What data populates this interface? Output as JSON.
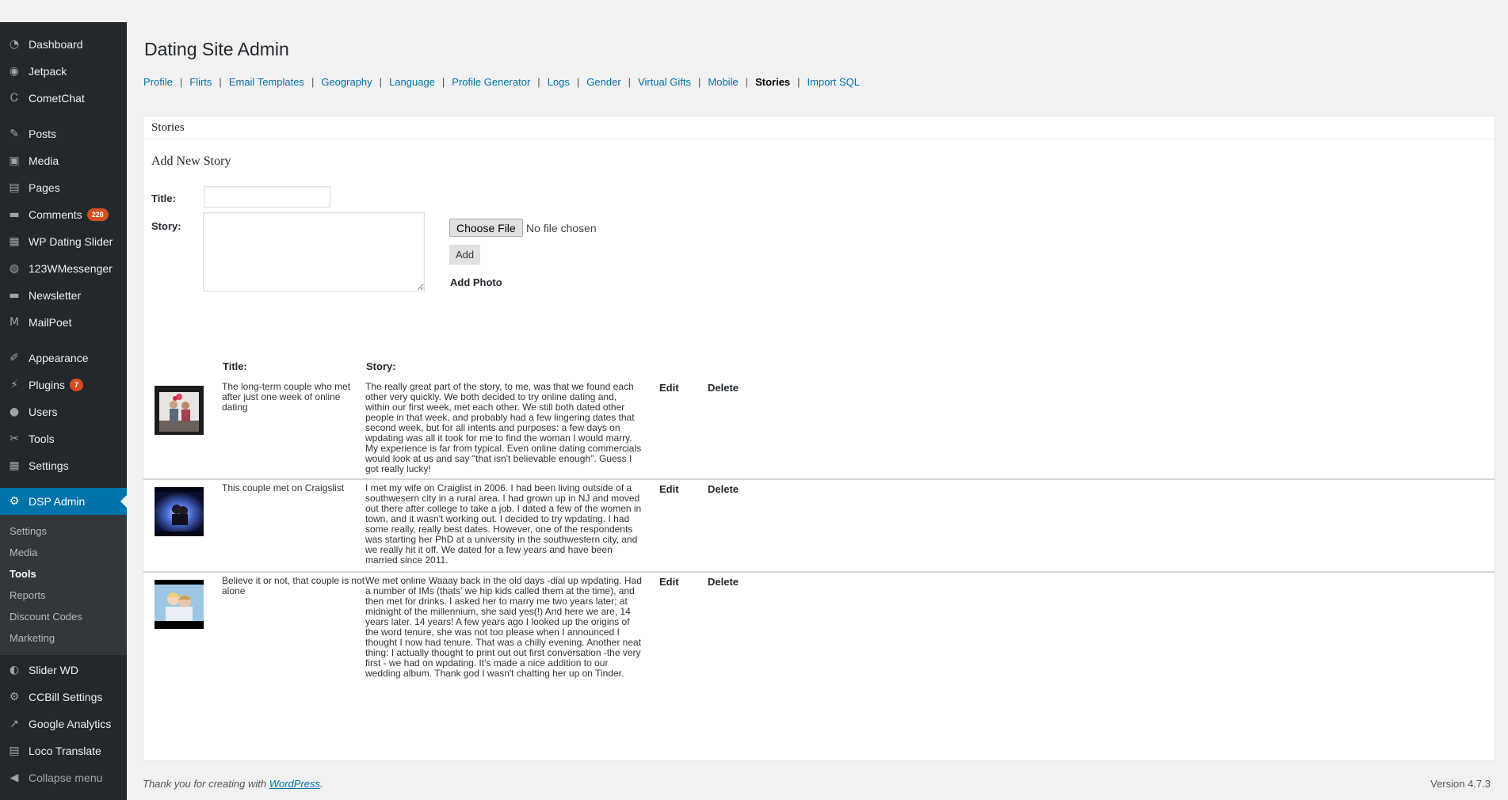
{
  "sidebar": {
    "group1": [
      {
        "label": "Dashboard",
        "icon": "dashboard-icon",
        "glyph": "◔"
      },
      {
        "label": "Jetpack",
        "icon": "jetpack-icon",
        "glyph": "◉"
      },
      {
        "label": "CometChat",
        "icon": "cometchat-icon",
        "glyph": "Ꮯ"
      }
    ],
    "group2": [
      {
        "label": "Posts",
        "icon": "pin-icon",
        "glyph": "✎"
      },
      {
        "label": "Media",
        "icon": "media-icon",
        "glyph": "▣"
      },
      {
        "label": "Pages",
        "icon": "pages-icon",
        "glyph": "▤"
      },
      {
        "label": "Comments",
        "icon": "comment-icon",
        "glyph": "▬",
        "badge": "228"
      },
      {
        "label": "WP Dating Slider",
        "icon": "slider-icon",
        "glyph": "▦"
      },
      {
        "label": "123WMessenger",
        "icon": "messenger-icon",
        "glyph": "◍"
      },
      {
        "label": "Newsletter",
        "icon": "newsletter-icon",
        "glyph": "▬"
      },
      {
        "label": "MailPoet",
        "icon": "mailpoet-icon",
        "glyph": "M"
      }
    ],
    "group3": [
      {
        "label": "Appearance",
        "icon": "brush-icon",
        "glyph": "✐"
      },
      {
        "label": "Plugins",
        "icon": "plug-icon",
        "glyph": "⚡",
        "badge": "7"
      },
      {
        "label": "Users",
        "icon": "user-icon",
        "glyph": "●"
      },
      {
        "label": "Tools",
        "icon": "wrench-icon",
        "glyph": "✂"
      },
      {
        "label": "Settings",
        "icon": "settings-icon",
        "glyph": "▦"
      }
    ],
    "active": {
      "label": "DSP Admin",
      "icon": "gear-icon",
      "glyph": "⚙"
    },
    "submenu": [
      "Settings",
      "Media",
      "Tools",
      "Reports",
      "Discount Codes",
      "Marketing"
    ],
    "submenu_current": "Tools",
    "group4": [
      {
        "label": "Slider WD",
        "icon": "slider-wd-icon",
        "glyph": "◐"
      },
      {
        "label": "CCBill Settings",
        "icon": "gear-icon",
        "glyph": "⚙"
      },
      {
        "label": "Google Analytics",
        "icon": "analytics-icon",
        "glyph": "↗"
      },
      {
        "label": "Loco Translate",
        "icon": "translate-icon",
        "glyph": "▤"
      }
    ],
    "collapse": {
      "label": "Collapse menu",
      "icon": "collapse-icon",
      "glyph": "◀"
    }
  },
  "page": {
    "title": "Dating Site Admin",
    "tabs": [
      "Profile",
      "Flirts",
      "Email Templates",
      "Geography",
      "Language",
      "Profile Generator",
      "Logs",
      "Gender",
      "Virtual Gifts",
      "Mobile",
      "Stories",
      "Import SQL"
    ],
    "current_tab": "Stories"
  },
  "panel": {
    "heading": "Stories",
    "form_title": "Add New Story",
    "title_label": "Title:",
    "story_label": "Story:",
    "title_value": "",
    "choose_file": "Choose File",
    "no_file": "No file chosen",
    "add": "Add",
    "add_photo": "Add Photo",
    "col_title": "Title:",
    "col_story": "Story:",
    "edit": "Edit",
    "delete": "Delete",
    "rows": [
      {
        "title": "The long-term couple who met after just one week of online dating",
        "story": "The really great part of the story, to me, was that we found each other very quickly. We both decided to try online dating and, within our first week, met each other. We still both dated other people in that week, and probably had a few lingering dates that second week, but for all intents and purposes: a few days on wpdating was all it took for me to find the woman I would marry. My experience is far from typical. Even online dating commercials would look at us and say \"that isn't believable enough\". Guess I got really lucky!"
      },
      {
        "title": "This couple met on Craigslist",
        "story": "I met my wife on Craiglist in 2006. I had been living outside of a southwesern city in a rural area. I had grown up in NJ and moved out there after college to take a job. I dated a few of the women in town, and it wasn't working out. I decided to try wpdating. I had some really, really best dates. However, one of the respondents was starting her PhD at a university in the southwestern city, and we really hit it off. We dated for a few years and have been married since 2011."
      },
      {
        "title": "Believe it or not, that couple is not alone",
        "story": "We met online Waaay back in the old days -dial up wpdating. Had a number of IMs (thats' we hip kids called them at the time), and then met for drinks. I asked her to marry me two years later; at midnight of the millennium, she said yes(!) And here we are, 14 years later. 14 years! A few years ago I looked up the origins of the word tenure, she was not too please when I announced I thought I now had tenure. That was a chilly evening. Another neat thing: I actually thought to print out out first conversation -the very first - we had on wpdating. It's made a nice addition to our wedding album. Thank god I wasn't chatting her up on Tinder."
      }
    ]
  },
  "footer": {
    "thanks_prefix": "Thank you for creating with ",
    "thanks_link": "WordPress",
    "thanks_suffix": ".",
    "version": "Version 4.7.3"
  },
  "colors": {
    "sidebar_bg": "#23282d",
    "submenu_bg": "#32373c",
    "active_bg": "#0073aa",
    "link": "#0073aa",
    "badge": "#d54e21"
  }
}
